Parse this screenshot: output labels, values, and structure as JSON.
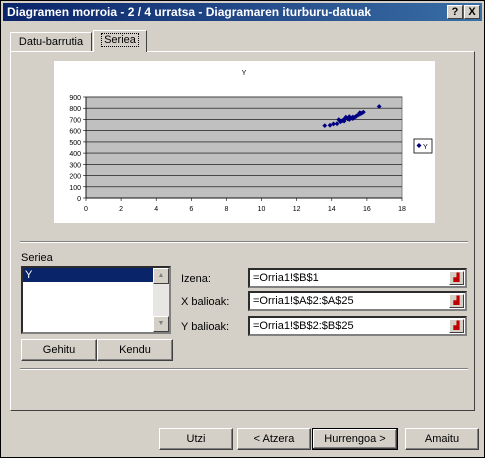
{
  "window": {
    "title": "Diagramen morroia - 2 / 4 urratsa - Diagramaren iturburu-datuak"
  },
  "titlebar_buttons": {
    "help": "?",
    "close": "X"
  },
  "tabs": [
    {
      "label": "Datu-barrutia",
      "active": false
    },
    {
      "label": "Seriea",
      "active": true
    }
  ],
  "chart_data": {
    "type": "scatter",
    "title": "Y",
    "xlim": [
      0,
      18
    ],
    "ylim": [
      0,
      900
    ],
    "xticks": [
      "0",
      "2",
      "4",
      "6",
      "8",
      "10",
      "12",
      "14",
      "16",
      "18"
    ],
    "yticks": [
      "0",
      "100",
      "200",
      "300",
      "400",
      "500",
      "600",
      "700",
      "800",
      "900"
    ],
    "legend": {
      "position": "right",
      "label": "Y"
    },
    "grid": true,
    "plot_background": "#c0c0c0",
    "marker_color": "#000080",
    "series": [
      {
        "name": "Y",
        "points": [
          [
            13.6,
            645
          ],
          [
            13.9,
            648
          ],
          [
            14.1,
            660
          ],
          [
            14.3,
            662
          ],
          [
            14.5,
            680
          ],
          [
            14.6,
            690
          ],
          [
            14.7,
            700
          ],
          [
            14.8,
            720
          ],
          [
            14.9,
            705
          ],
          [
            15.0,
            700
          ],
          [
            15.1,
            712
          ],
          [
            15.2,
            722
          ],
          [
            15.3,
            718
          ],
          [
            15.4,
            730
          ],
          [
            15.5,
            740
          ],
          [
            15.6,
            760
          ],
          [
            15.7,
            755
          ],
          [
            15.8,
            765
          ],
          [
            14.7,
            685
          ],
          [
            15.0,
            725
          ],
          [
            15.2,
            708
          ],
          [
            14.4,
            698
          ],
          [
            15.6,
            748
          ],
          [
            16.7,
            815
          ]
        ]
      }
    ]
  },
  "series_section": {
    "label": "Seriea",
    "items": [
      "Y"
    ],
    "add_button": "Gehitu",
    "remove_button": "Kendu"
  },
  "fields": {
    "name_label": "Izena:",
    "name_value": "=Orria1!$B$1",
    "x_label": "X balioak:",
    "x_value": "=Orria1!$A$2:$A$25",
    "y_label": "Y balioak:",
    "y_value": "=Orria1!$B$2:$B$25"
  },
  "buttons": {
    "cancel": "Utzi",
    "back": "< Atzera",
    "next": "Hurrengoa >",
    "finish": "Amaitu"
  }
}
